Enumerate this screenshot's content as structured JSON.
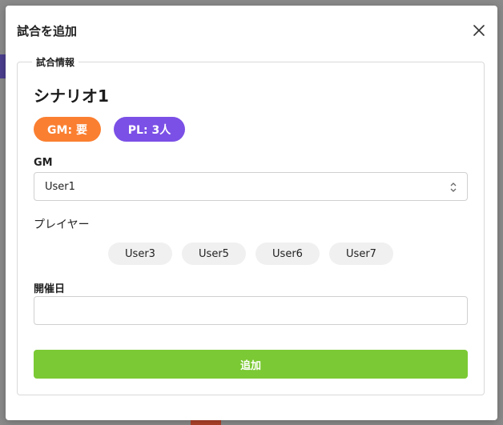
{
  "modal": {
    "title": "試合を追加"
  },
  "section": {
    "legend": "試合情報",
    "scenario_name": "シナリオ1",
    "badges": {
      "gm": "GM: 要",
      "pl": "PL: 3人"
    }
  },
  "gm_field": {
    "label": "GM",
    "value": "User1"
  },
  "players": {
    "label": "プレイヤー",
    "chips": [
      "User3",
      "User5",
      "User6",
      "User7"
    ]
  },
  "date_field": {
    "label": "開催日",
    "value": ""
  },
  "submit": {
    "label": "追加"
  },
  "colors": {
    "gm_badge": "#fb7f31",
    "pl_badge": "#7b50e6",
    "submit": "#7bc934"
  },
  "icons": {
    "close": "close-icon",
    "select": "chevron-up-down-icon"
  }
}
